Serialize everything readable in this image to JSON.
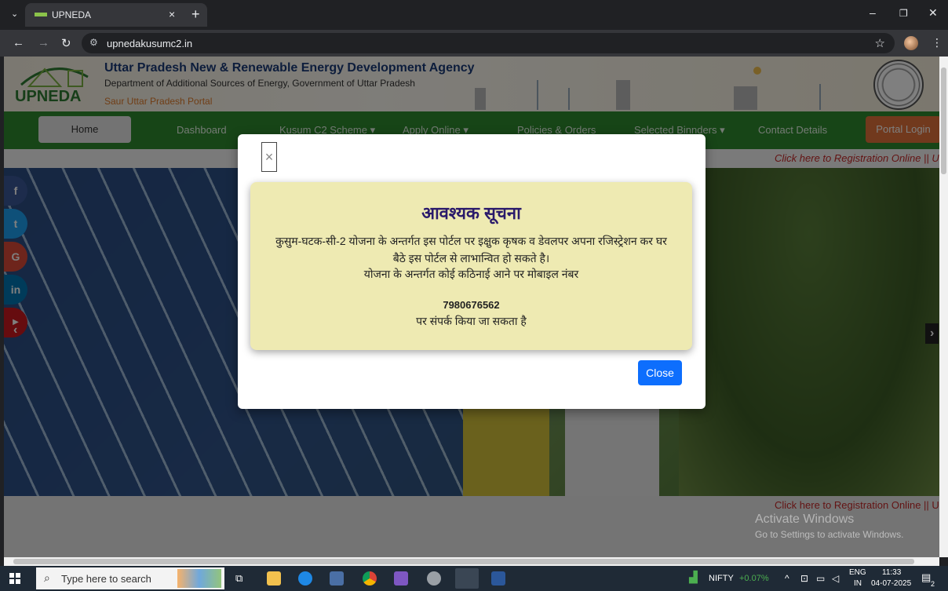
{
  "browser": {
    "tab_title": "UPNEDA",
    "tab_close": "×",
    "new_tab": "+",
    "url": "upnedakusumc2.in",
    "window_minimize": "–",
    "window_restore": "❐",
    "window_close": "✕"
  },
  "header": {
    "agency_title": "Uttar Pradesh New & Renewable Energy Development Agency",
    "department": "Department of Additional Sources of Energy, Government of Uttar Pradesh",
    "portal": "Saur Uttar Pradesh Portal",
    "logo_text": "UPNEDA"
  },
  "nav": {
    "home": "Home",
    "dashboard": "Dashboard",
    "kusum": "Kusum C2 Scheme ▾",
    "apply": "Apply Online ▾",
    "policies": "Policies & Orders",
    "bidders": "Selected Binnders ▾",
    "contact": "Contact Details",
    "login": "Portal Login"
  },
  "marquee": "Click here to Registration Online || U",
  "social": [
    "f",
    "t",
    "G",
    "in",
    "▶"
  ],
  "modal": {
    "close_x": "×",
    "heading": "आवश्यक सूचना",
    "line1": "कुसुम-घटक-सी-2 योजना के अन्तर्गत इस पोर्टल पर इक्षुक कृषक व डेवलपर अपना रजिस्ट्रेशन कर घर",
    "line2": "बैठे इस पोर्टल से लाभान्वित हो सकते है।",
    "line3": "योजना के अन्तर्गत कोई कठिनाई आने पर मोबाइल नंबर",
    "phone": "7980676562",
    "line4": "पर संपर्क किया जा सकता है",
    "close_button": "Close"
  },
  "watermark": {
    "line1": "Activate Windows",
    "line2": "Go to Settings to activate Windows."
  },
  "taskbar": {
    "search_placeholder": "Type here to search",
    "nifty_label": "NIFTY",
    "nifty_change": "+0.07%",
    "lang1": "ENG",
    "lang2": "IN",
    "time": "11:33",
    "date": "04-07-2025",
    "notif_count": "2"
  },
  "colors": {
    "nav_green": "#2e8b2e",
    "login_orange": "#e2733a",
    "notice_bg": "#eeeab2",
    "close_blue": "#0d6efd",
    "nifty_green": "#4caf50"
  }
}
